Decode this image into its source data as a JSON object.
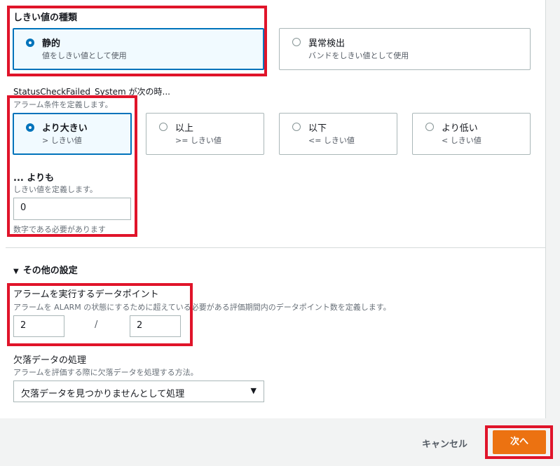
{
  "threshold_type": {
    "label": "しきい値の種類",
    "options": [
      {
        "title": "静的",
        "sub": "値をしきい値として使用",
        "selected": true
      },
      {
        "title": "異常検出",
        "sub": "バンドをしきい値として使用",
        "selected": false
      }
    ]
  },
  "condition": {
    "label": "StatusCheckFailed_System が次の時...",
    "desc": "アラーム条件を定義します。",
    "options": [
      {
        "title": "より大きい",
        "sub": "> しきい値",
        "selected": true
      },
      {
        "title": "以上",
        "sub": ">= しきい値",
        "selected": false
      },
      {
        "title": "以下",
        "sub": "<= しきい値",
        "selected": false
      },
      {
        "title": "より低い",
        "sub": "< しきい値",
        "selected": false
      }
    ]
  },
  "threshold_value": {
    "label": "... よりも",
    "desc": "しきい値を定義します。",
    "value": "0",
    "hint": "数字である必要があります"
  },
  "additional": {
    "label": "その他の設定",
    "expanded_icon": "caret-down-icon"
  },
  "datapoints": {
    "label": "アラームを実行するデータポイント",
    "desc": "アラームを ALARM の状態にするために超えている必要がある評価期間内のデータポイント数を定義します。",
    "value1": "2",
    "separator": "/",
    "value2": "2"
  },
  "missing_data": {
    "label": "欠落データの処理",
    "desc": "アラームを評価する際に欠落データを処理する方法。",
    "selected": "欠落データを見つかりませんとして処理"
  },
  "footer": {
    "cancel": "キャンセル",
    "next": "次へ"
  },
  "colors": {
    "accent": "#0073bb",
    "primary_button": "#ec7211",
    "highlight": "#e0142a"
  }
}
